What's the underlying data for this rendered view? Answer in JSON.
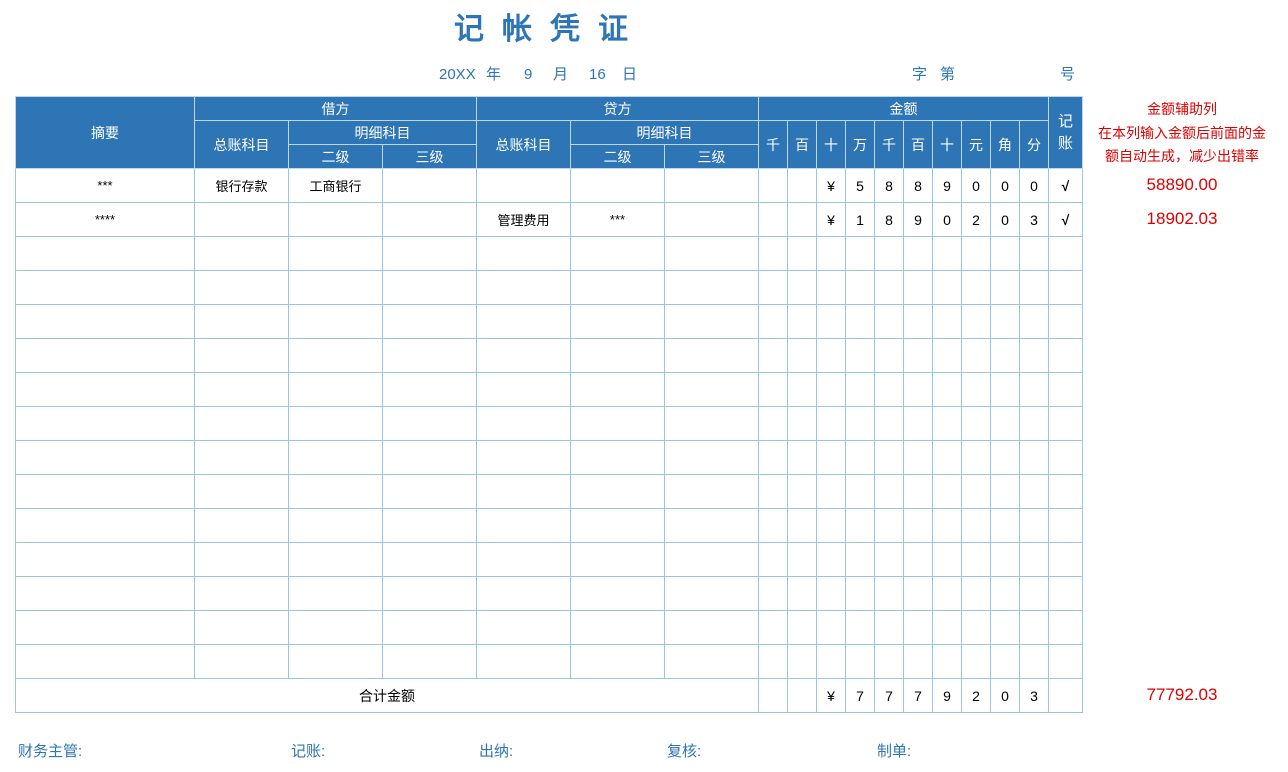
{
  "title": "记帐凭证",
  "date": {
    "year": "20XX",
    "year_unit": "年",
    "month": "9",
    "month_unit": "月",
    "day": "16",
    "day_unit": "日"
  },
  "voucher_no": {
    "zi": "字",
    "di": "第",
    "hao": "号"
  },
  "header": {
    "summary": "摘要",
    "debit": "借方",
    "credit": "贷方",
    "amount": "金额",
    "posted": "记账",
    "general_account": "总账科目",
    "detail_account": "明细科目",
    "level2": "二级",
    "level3": "三级",
    "units": [
      "千",
      "百",
      "十",
      "万",
      "千",
      "百",
      "十",
      "元",
      "角",
      "分"
    ]
  },
  "rows": [
    {
      "summary": "***",
      "debit_general": "银行存款",
      "debit_l2": "工商银行",
      "debit_l3": "",
      "credit_general": "",
      "credit_l2": "",
      "credit_l3": "",
      "digits": [
        "",
        "",
        "¥",
        "5",
        "8",
        "8",
        "9",
        "0",
        "0",
        "0"
      ],
      "posted": "√"
    },
    {
      "summary": "****",
      "debit_general": "",
      "debit_l2": "",
      "debit_l3": "",
      "credit_general": "管理费用",
      "credit_l2": "***",
      "credit_l3": "",
      "digits": [
        "",
        "",
        "¥",
        "1",
        "8",
        "9",
        "0",
        "2",
        "0",
        "3"
      ],
      "posted": "√"
    }
  ],
  "empty_rows": 13,
  "total": {
    "label": "合计金额",
    "digits": [
      "",
      "",
      "¥",
      "7",
      "7",
      "7",
      "9",
      "2",
      "0",
      "3"
    ],
    "posted": ""
  },
  "helper": {
    "title": "金额辅助列",
    "note_line1": "在本列输入金额后前面的金",
    "note_line2": "额自动生成，减少出错率",
    "values": [
      "58890.00",
      "18902.03"
    ],
    "total": "77792.03"
  },
  "footer": {
    "manager": "财务主管:",
    "bookkeeper": "记账:",
    "cashier": "出纳:",
    "reviewer": "复核:",
    "preparer": "制单:"
  },
  "colors": {
    "header_bg": "#2E75B6",
    "grid": "#9DC3E6",
    "accent_red": "#E00000"
  }
}
